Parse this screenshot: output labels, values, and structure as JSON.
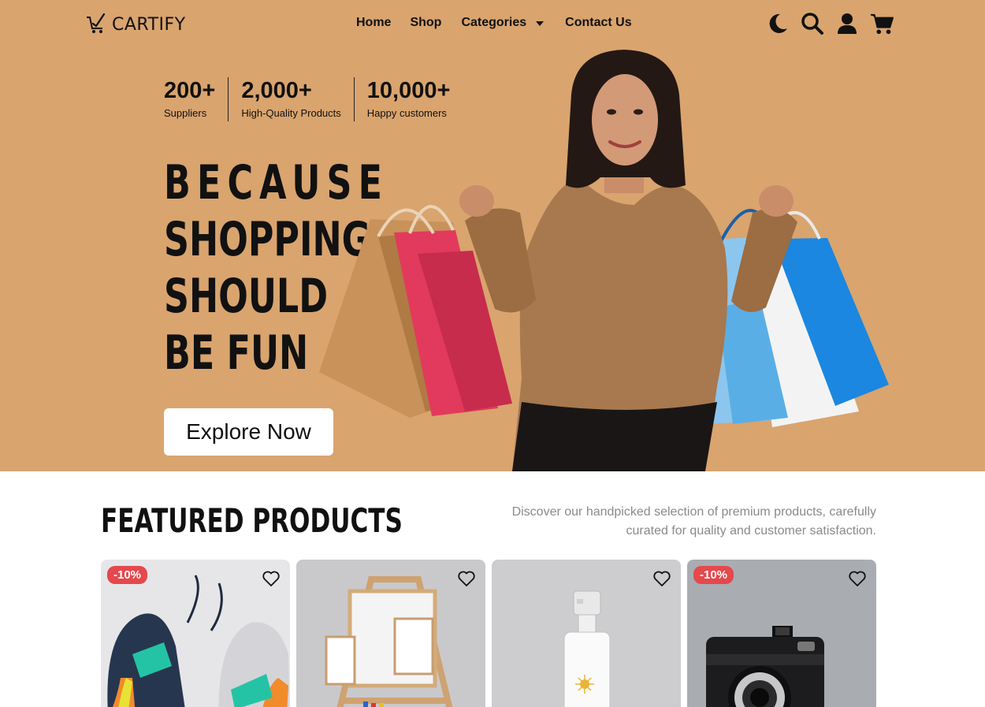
{
  "brand": {
    "name": "CARTIFY"
  },
  "nav": {
    "links": [
      "Home",
      "Shop",
      "Categories",
      "Contact Us"
    ],
    "icons": [
      "moon-icon",
      "search-icon",
      "user-icon",
      "cart-icon"
    ]
  },
  "hero": {
    "stats": [
      {
        "value": "200+",
        "label": "Suppliers"
      },
      {
        "value": "2,000+",
        "label": "High-Quality Products"
      },
      {
        "value": "10,000+",
        "label": "Happy customers"
      }
    ],
    "headline": [
      "BECAUSE",
      "SHOPPING",
      "SHOULD",
      "BE FUN"
    ],
    "cta": "Explore Now"
  },
  "featured": {
    "title": "FEATURED PRODUCTS",
    "description": "Discover our handpicked selection of premium products, carefully curated for quality and customer satisfaction.",
    "products": [
      {
        "badge": "-10%",
        "image": "running-shoes"
      },
      {
        "badge": "",
        "image": "wooden-easel"
      },
      {
        "badge": "",
        "image": "pump-bottle"
      },
      {
        "badge": "-10%",
        "image": "camera"
      }
    ]
  },
  "colors": {
    "hero_bg": "#d9a46e",
    "badge": "#e5484d",
    "text": "#111111",
    "muted": "#8a8a8a"
  }
}
